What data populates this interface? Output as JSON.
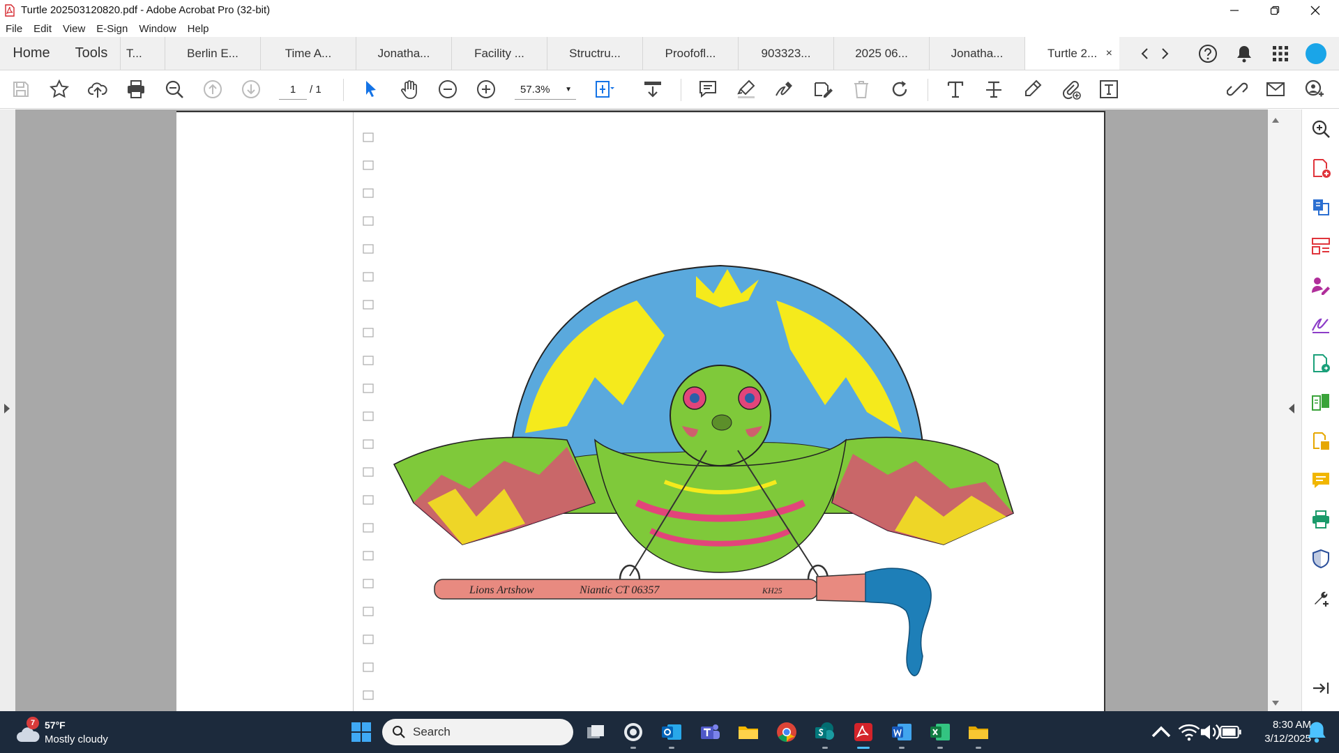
{
  "window": {
    "title": "Turtle 202503120820.pdf - Adobe Acrobat Pro (32-bit)",
    "controls": [
      "minimize",
      "restore",
      "close"
    ]
  },
  "menu": [
    "File",
    "Edit",
    "View",
    "E-Sign",
    "Window",
    "Help"
  ],
  "tabs": {
    "home": "Home",
    "tools": "Tools",
    "documents": [
      {
        "label": "T...",
        "active": false
      },
      {
        "label": "Berlin E...",
        "active": false
      },
      {
        "label": "Time A...",
        "active": false
      },
      {
        "label": "Jonatha...",
        "active": false
      },
      {
        "label": "Facility ...",
        "active": false
      },
      {
        "label": "Structru...",
        "active": false
      },
      {
        "label": "Proofofl...",
        "active": false
      },
      {
        "label": "903323...",
        "active": false
      },
      {
        "label": "2025 06...",
        "active": false
      },
      {
        "label": "Jonatha...",
        "active": false
      },
      {
        "label": "Turtle 2...",
        "active": true
      }
    ],
    "close_glyph": "×"
  },
  "toolbar": {
    "page_current": "1",
    "page_total": "/ 1",
    "zoom": "57.3%",
    "icons": [
      "save-icon",
      "star-icon",
      "upload-cloud-icon",
      "print-icon",
      "zoom-out-magnifier-icon",
      "prev-page-icon",
      "next-page-icon",
      "select-arrow-icon",
      "hand-icon",
      "zoom-out-icon",
      "zoom-in-icon",
      "fit-page-icon",
      "scroll-mode-icon",
      "comment-icon",
      "highlight-icon",
      "draw-icon",
      "sign-icon",
      "delete-icon",
      "rotate-icon",
      "text-icon",
      "strikethrough-icon",
      "pencil-icon",
      "attach-icon",
      "textbox-icon",
      "link-icon",
      "email-icon",
      "share-user-icon"
    ]
  },
  "document": {
    "artwork_text": {
      "brush_left": "Lions Artshow",
      "brush_middle": "Niantic CT 06357",
      "brush_right": "KH25"
    },
    "colors": {
      "yellow": "#f5ea1c",
      "blue": "#5aa9dd",
      "green": "#7fc93a",
      "pink": "#e2457a",
      "brush": "#e88a80",
      "bristles": "#1e7fb8"
    }
  },
  "right_panel": {
    "icons": [
      "search-zoom-icon",
      "create-pdf-icon",
      "export-pdf-icon",
      "organize-pages-icon",
      "fill-sign-icon",
      "request-signature-icon",
      "edit-pdf-icon",
      "compare-icon",
      "combine-files-icon",
      "comment-panel-icon",
      "print-production-icon",
      "protect-icon",
      "more-tools-icon",
      "collapse-panel-icon"
    ]
  },
  "taskbar": {
    "weather": {
      "badge": "7",
      "temp": "57°F",
      "condition": "Mostly cloudy"
    },
    "search_label": "Search",
    "apps": [
      "windows-start-icon",
      "task-view-icon",
      "browser-icon",
      "outlook-icon",
      "teams-icon",
      "file-explorer-icon",
      "chrome-icon",
      "sharepoint-icon",
      "acrobat-icon",
      "word-icon",
      "excel-icon",
      "folder-icon"
    ],
    "clock": {
      "time": "8:30 AM",
      "date": "3/12/2025"
    },
    "tray_icons": [
      "chevron-up-icon",
      "wifi-icon",
      "volume-icon",
      "battery-icon",
      "notification-bell-icon"
    ]
  }
}
